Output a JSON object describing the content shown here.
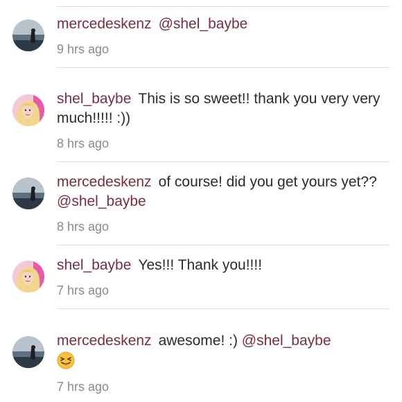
{
  "comments": [
    {
      "username": "mercedeskenz",
      "text": "",
      "mention": "@shel_baybe",
      "time": "9 hrs ago",
      "avatar_icon": "seascape-avatar"
    },
    {
      "username": "shel_baybe",
      "text": "This is so sweet!! thank you very very much!!!!! :))",
      "mention": "",
      "time": "8 hrs ago",
      "avatar_icon": "blonde-girl-avatar"
    },
    {
      "username": "mercedeskenz",
      "text": "of course! did you get yours yet?? ",
      "mention": "@shel_baybe",
      "time": "8 hrs ago",
      "avatar_icon": "seascape-avatar"
    },
    {
      "username": "shel_baybe",
      "text": "Yes!!! Thank you!!!!",
      "mention": "",
      "time": "7 hrs ago",
      "avatar_icon": "blonde-girl-avatar"
    },
    {
      "username": "mercedeskenz",
      "text": "awesome! :) ",
      "mention": "@shel_baybe",
      "time": "7 hrs ago",
      "avatar_icon": "seascape-avatar",
      "emoji_icon": "squinting-tongue-emoji-icon"
    }
  ],
  "colors": {
    "username": "#7a2e3b",
    "text": "#2b2b2b",
    "time": "#8a8a8a",
    "divider": "#dcdcdc"
  }
}
